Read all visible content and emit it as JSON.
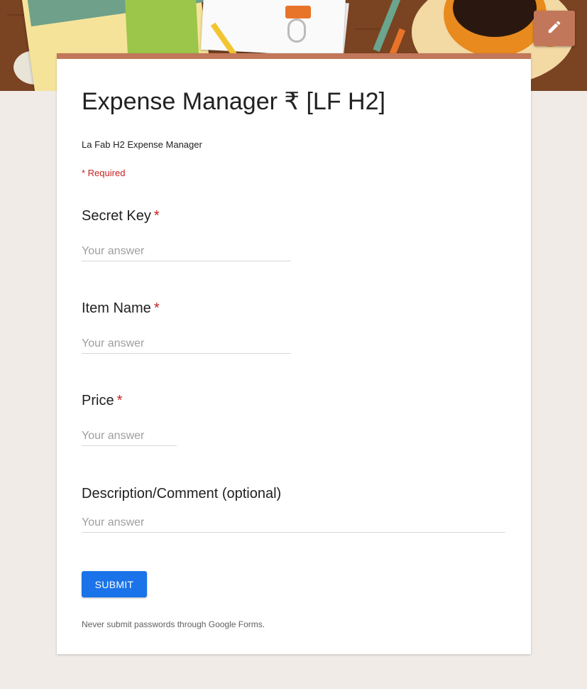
{
  "form": {
    "title": "Expense Manager ₹ [LF H2]",
    "description": "La Fab H2 Expense Manager",
    "required_note": "* Required",
    "questions": [
      {
        "label": "Secret Key",
        "required_mark": "*",
        "placeholder": "Your answer",
        "value": ""
      },
      {
        "label": "Item Name",
        "required_mark": "*",
        "placeholder": "Your answer",
        "value": ""
      },
      {
        "label": "Price",
        "required_mark": "*",
        "placeholder": "Your answer",
        "value": ""
      },
      {
        "label": "Description/Comment (optional)",
        "required_mark": "",
        "placeholder": "Your answer",
        "value": ""
      }
    ],
    "submit_label": "SUBMIT",
    "footer_note": "Never submit passwords through Google Forms."
  },
  "header": {
    "edit_icon": "pencil-icon"
  },
  "colors": {
    "theme_accent": "#c2775a",
    "required_red": "#c5221f",
    "submit_blue": "#1a73e8",
    "page_background": "#f0ebe6"
  }
}
